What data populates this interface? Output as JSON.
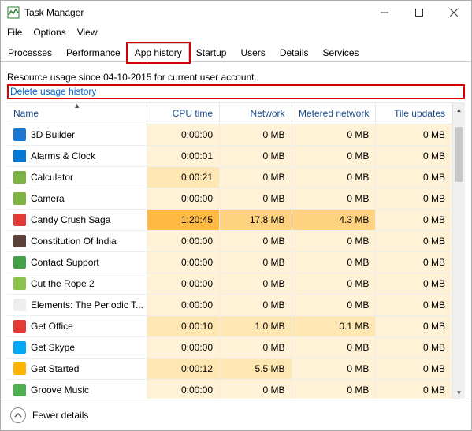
{
  "window": {
    "title": "Task Manager"
  },
  "menu": {
    "file": "File",
    "options": "Options",
    "view": "View"
  },
  "tabs": {
    "processes": "Processes",
    "performance": "Performance",
    "app_history": "App history",
    "startup": "Startup",
    "users": "Users",
    "details": "Details",
    "services": "Services"
  },
  "info": {
    "resource_usage_text": "Resource usage since 04-10-2015 for current user account.",
    "delete_link": "Delete usage history"
  },
  "columns": {
    "name": "Name",
    "cpu_time": "CPU time",
    "network": "Network",
    "metered_network": "Metered network",
    "tile_updates": "Tile updates"
  },
  "rows": [
    {
      "name": "3D Builder",
      "icon_color": "#1976d2",
      "cpu_time": "0:00:00",
      "cpu_heat": 1,
      "network": "0 MB",
      "net_heat": 1,
      "metered": "0 MB",
      "met_heat": 1,
      "tile": "0 MB",
      "tile_heat": 1
    },
    {
      "name": "Alarms & Clock",
      "icon_color": "#0078d7",
      "cpu_time": "0:00:01",
      "cpu_heat": 1,
      "network": "0 MB",
      "net_heat": 1,
      "metered": "0 MB",
      "met_heat": 1,
      "tile": "0 MB",
      "tile_heat": 1
    },
    {
      "name": "Calculator",
      "icon_color": "#7cb342",
      "cpu_time": "0:00:21",
      "cpu_heat": 2,
      "network": "0 MB",
      "net_heat": 1,
      "metered": "0 MB",
      "met_heat": 1,
      "tile": "0 MB",
      "tile_heat": 1
    },
    {
      "name": "Camera",
      "icon_color": "#7cb342",
      "cpu_time": "0:00:00",
      "cpu_heat": 1,
      "network": "0 MB",
      "net_heat": 1,
      "metered": "0 MB",
      "met_heat": 1,
      "tile": "0 MB",
      "tile_heat": 1
    },
    {
      "name": "Candy Crush Saga",
      "icon_color": "#e53935",
      "cpu_time": "1:20:45",
      "cpu_heat": 4,
      "network": "17.8 MB",
      "net_heat": 3,
      "metered": "4.3 MB",
      "met_heat": 3,
      "tile": "0 MB",
      "tile_heat": 1
    },
    {
      "name": "Constitution Of India",
      "icon_color": "#5d4037",
      "cpu_time": "0:00:00",
      "cpu_heat": 1,
      "network": "0 MB",
      "net_heat": 1,
      "metered": "0 MB",
      "met_heat": 1,
      "tile": "0 MB",
      "tile_heat": 1
    },
    {
      "name": "Contact Support",
      "icon_color": "#43a047",
      "cpu_time": "0:00:00",
      "cpu_heat": 1,
      "network": "0 MB",
      "net_heat": 1,
      "metered": "0 MB",
      "met_heat": 1,
      "tile": "0 MB",
      "tile_heat": 1
    },
    {
      "name": "Cut the Rope 2",
      "icon_color": "#8bc34a",
      "cpu_time": "0:00:00",
      "cpu_heat": 1,
      "network": "0 MB",
      "net_heat": 1,
      "metered": "0 MB",
      "met_heat": 1,
      "tile": "0 MB",
      "tile_heat": 1
    },
    {
      "name": "Elements: The Periodic T...",
      "icon_color": "#eeeeee",
      "cpu_time": "0:00:00",
      "cpu_heat": 1,
      "network": "0 MB",
      "net_heat": 1,
      "metered": "0 MB",
      "met_heat": 1,
      "tile": "0 MB",
      "tile_heat": 1
    },
    {
      "name": "Get Office",
      "icon_color": "#e53935",
      "cpu_time": "0:00:10",
      "cpu_heat": 2,
      "network": "1.0 MB",
      "net_heat": 2,
      "metered": "0.1 MB",
      "met_heat": 2,
      "tile": "0 MB",
      "tile_heat": 1
    },
    {
      "name": "Get Skype",
      "icon_color": "#03a9f4",
      "cpu_time": "0:00:00",
      "cpu_heat": 1,
      "network": "0 MB",
      "net_heat": 1,
      "metered": "0 MB",
      "met_heat": 1,
      "tile": "0 MB",
      "tile_heat": 1
    },
    {
      "name": "Get Started",
      "icon_color": "#ffb300",
      "cpu_time": "0:00:12",
      "cpu_heat": 2,
      "network": "5.5 MB",
      "net_heat": 2,
      "metered": "0 MB",
      "met_heat": 1,
      "tile": "0 MB",
      "tile_heat": 1
    },
    {
      "name": "Groove Music",
      "icon_color": "#4caf50",
      "cpu_time": "0:00:00",
      "cpu_heat": 1,
      "network": "0 MB",
      "net_heat": 1,
      "metered": "0 MB",
      "met_heat": 1,
      "tile": "0 MB",
      "tile_heat": 1
    }
  ],
  "footer": {
    "fewer_details": "Fewer details"
  }
}
